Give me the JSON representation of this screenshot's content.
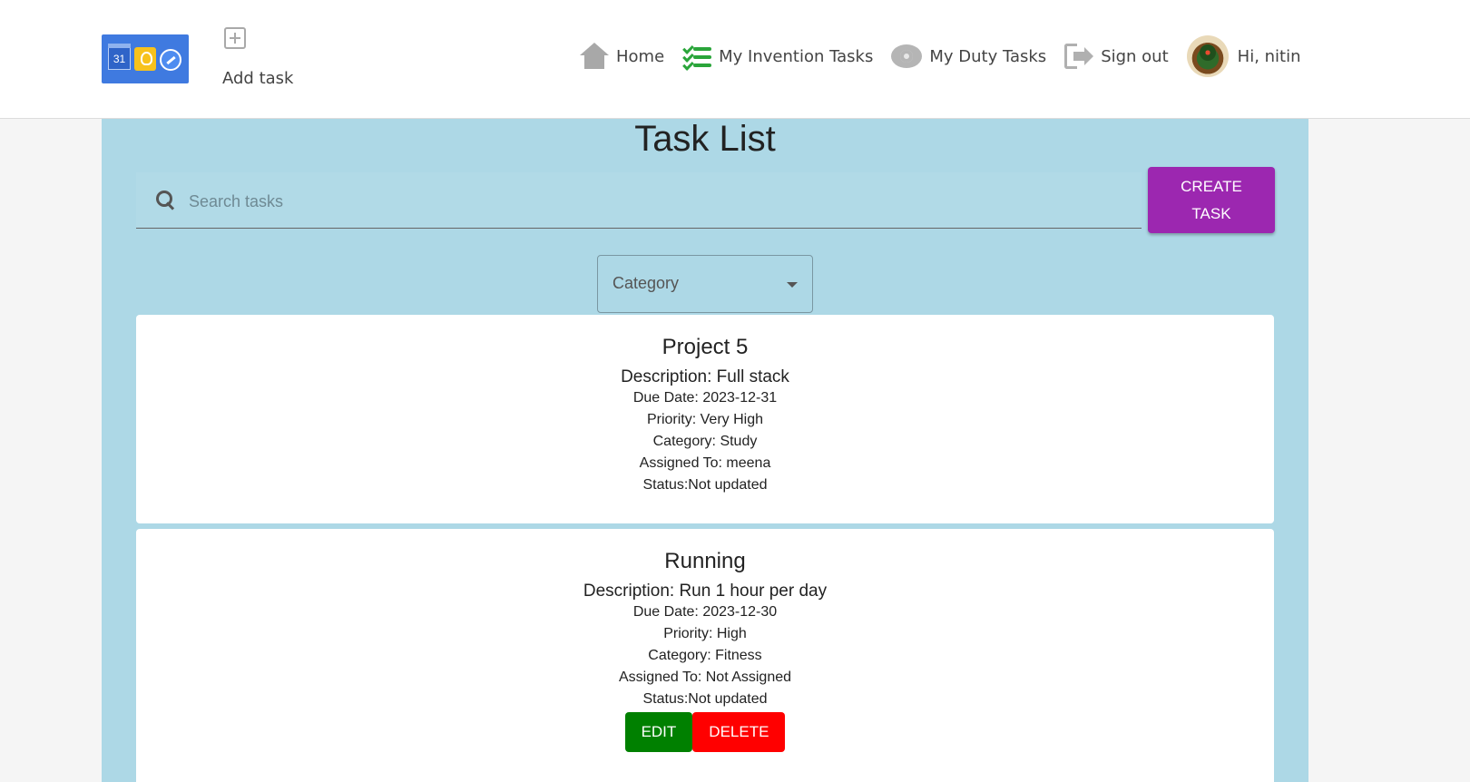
{
  "header": {
    "logo_date": "31",
    "add_task_label": "Add task",
    "nav": [
      {
        "label": "Home",
        "icon": "home-icon"
      },
      {
        "label": "My Invention Tasks",
        "icon": "checklist-icon"
      },
      {
        "label": "My Duty Tasks",
        "icon": "eye-icon"
      },
      {
        "label": "Sign out",
        "icon": "sign-out-icon"
      }
    ],
    "greeting": "Hi, nitin"
  },
  "main": {
    "title": "Task List",
    "search_placeholder": "Search tasks",
    "create_button": "CREATE TASK",
    "category_label": "Category",
    "tasks": [
      {
        "title": "Project 5",
        "description": "Description: Full stack",
        "due_date": "Due Date: 2023-12-31",
        "priority": "Priority: Very High",
        "category": "Category: Study",
        "assigned_to": "Assigned To: meena",
        "status": "Status:Not updated"
      },
      {
        "title": "Running",
        "description": "Description: Run 1 hour per day",
        "due_date": "Due Date: 2023-12-30",
        "priority": "Priority: High",
        "category": "Category: Fitness",
        "assigned_to": "Assigned To: Not Assigned",
        "status": "Status:Not updated",
        "edit_label": "EDIT",
        "delete_label": "DELETE"
      }
    ]
  },
  "colors": {
    "main_background": "#add8e6",
    "create_button": "#9c27b0",
    "edit_button": "#008000",
    "delete_button": "#ff0000"
  }
}
